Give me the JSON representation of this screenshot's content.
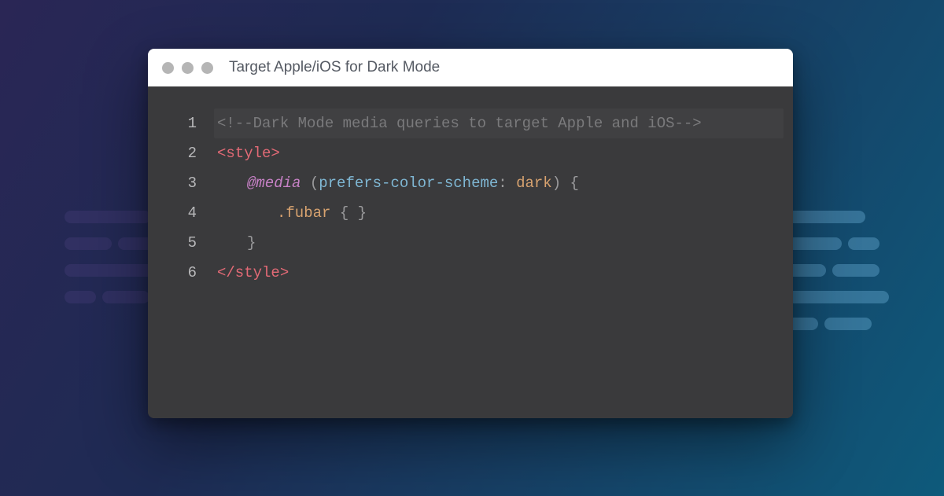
{
  "window": {
    "title": "Target Apple/iOS for Dark Mode"
  },
  "code": {
    "line1_comment": "<!--Dark Mode media queries to target Apple and iOS-->",
    "line2_open": "<style>",
    "line3_keyword": "@media",
    "line3_paren_open": "(",
    "line3_prop": "prefers-color-scheme",
    "line3_colon": ":",
    "line3_value": " dark",
    "line3_paren_close": ")",
    "line3_brace_open": " {",
    "line4_selector": ".fubar",
    "line4_braces": " { }",
    "line5_brace_close": "}",
    "line6_close": "</style>"
  },
  "gutter": {
    "n1": "1",
    "n2": "2",
    "n3": "3",
    "n4": "4",
    "n5": "5",
    "n6": "6"
  }
}
